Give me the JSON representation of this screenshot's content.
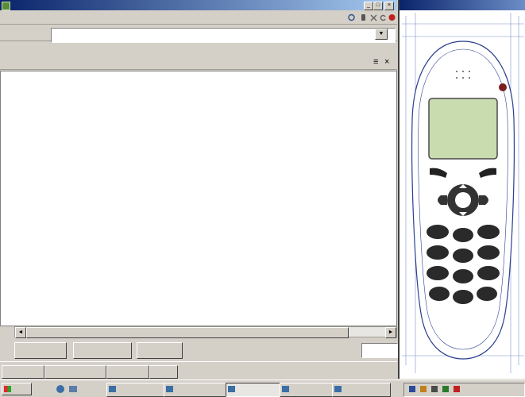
{
  "window": {
    "title": "",
    "controls": [
      {
        "name": "minimize",
        "glyph": "_"
      },
      {
        "name": "maximize",
        "glyph": "□"
      },
      {
        "name": "close",
        "glyph": "×"
      }
    ]
  },
  "menu": [
    {
      "label": ""
    },
    {
      "label": ""
    },
    {
      "label": ""
    },
    {
      "label": ""
    },
    {
      "label": ""
    }
  ],
  "toolbar_icons": [
    {
      "name": "browser-icon",
      "color": "#2b4b8f"
    },
    {
      "name": "phone-icon",
      "color": "#555555"
    },
    {
      "name": "stop-icon",
      "color": "#606060"
    },
    {
      "name": "refresh-icon",
      "color": "#606060"
    },
    {
      "name": "home-icon",
      "color": "#c02020"
    }
  ],
  "url_bar": {
    "label": "",
    "value": ""
  },
  "file_tab": {
    "path": ""
  },
  "code_lines": [
    {
      "text": ""
    },
    {
      "text": ""
    },
    {
      "text": ""
    },
    {
      "text": ""
    },
    {
      "text": ""
    },
    {
      "text": ""
    },
    {
      "text": ""
    }
  ],
  "actions": {
    "button_1": "",
    "button_2": "",
    "button_3": "",
    "position_label": "",
    "position_value": ""
  },
  "bottom_tabs": [
    {
      "label": ""
    },
    {
      "label": ""
    },
    {
      "label": ""
    },
    {
      "label": ""
    }
  ],
  "simulator": {
    "screen_text": "",
    "brand_text": "",
    "bottom_label": "",
    "colors": {
      "body": "#ffffff",
      "outline": "#2b3f8f",
      "keys": "#222222",
      "screen": "#c8dcb0"
    }
  },
  "taskbar": {
    "start_label": "",
    "tasks": [
      {
        "label": ""
      },
      {
        "label": ""
      },
      {
        "label": ""
      },
      {
        "label": "",
        "active": true
      },
      {
        "label": ""
      },
      {
        "label": ""
      }
    ],
    "clock": ""
  }
}
